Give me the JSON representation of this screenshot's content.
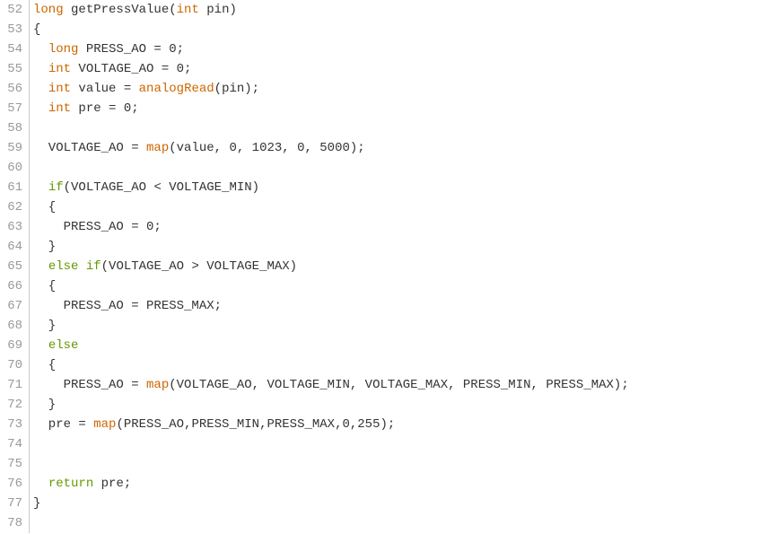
{
  "lines": [
    {
      "n": 52,
      "tokens": [
        {
          "t": "long",
          "c": "kw-type"
        },
        {
          "t": " ",
          "c": ""
        },
        {
          "t": "getPressValue",
          "c": "kw-ident"
        },
        {
          "t": "(",
          "c": "kw-punct"
        },
        {
          "t": "int",
          "c": "kw-type"
        },
        {
          "t": " pin)",
          "c": "kw-ident"
        }
      ]
    },
    {
      "n": 53,
      "tokens": [
        {
          "t": "{",
          "c": "kw-punct"
        }
      ]
    },
    {
      "n": 54,
      "tokens": [
        {
          "t": "  ",
          "c": ""
        },
        {
          "t": "long",
          "c": "kw-type"
        },
        {
          "t": " PRESS_AO = 0;",
          "c": "kw-ident"
        }
      ]
    },
    {
      "n": 55,
      "tokens": [
        {
          "t": "  ",
          "c": ""
        },
        {
          "t": "int",
          "c": "kw-type"
        },
        {
          "t": " VOLTAGE_AO = 0;",
          "c": "kw-ident"
        }
      ]
    },
    {
      "n": 56,
      "tokens": [
        {
          "t": "  ",
          "c": ""
        },
        {
          "t": "int",
          "c": "kw-type"
        },
        {
          "t": " value = ",
          "c": "kw-ident"
        },
        {
          "t": "analogRead",
          "c": "kw-func"
        },
        {
          "t": "(pin);",
          "c": "kw-ident"
        }
      ]
    },
    {
      "n": 57,
      "tokens": [
        {
          "t": "  ",
          "c": ""
        },
        {
          "t": "int",
          "c": "kw-type"
        },
        {
          "t": " pre = 0;",
          "c": "kw-ident"
        }
      ]
    },
    {
      "n": 58,
      "tokens": [
        {
          "t": "",
          "c": ""
        }
      ]
    },
    {
      "n": 59,
      "tokens": [
        {
          "t": "  VOLTAGE_AO = ",
          "c": "kw-ident"
        },
        {
          "t": "map",
          "c": "kw-func"
        },
        {
          "t": "(value, 0, 1023, 0, 5000);",
          "c": "kw-ident"
        }
      ]
    },
    {
      "n": 60,
      "tokens": [
        {
          "t": "",
          "c": ""
        }
      ]
    },
    {
      "n": 61,
      "tokens": [
        {
          "t": "  ",
          "c": ""
        },
        {
          "t": "if",
          "c": "kw-ctrl"
        },
        {
          "t": "(VOLTAGE_AO < VOLTAGE_MIN)",
          "c": "kw-ident"
        }
      ]
    },
    {
      "n": 62,
      "tokens": [
        {
          "t": "  {",
          "c": "kw-punct"
        }
      ]
    },
    {
      "n": 63,
      "tokens": [
        {
          "t": "    PRESS_AO = 0;",
          "c": "kw-ident"
        }
      ]
    },
    {
      "n": 64,
      "tokens": [
        {
          "t": "  }",
          "c": "kw-punct"
        }
      ]
    },
    {
      "n": 65,
      "tokens": [
        {
          "t": "  ",
          "c": ""
        },
        {
          "t": "else",
          "c": "kw-ctrl"
        },
        {
          "t": " ",
          "c": ""
        },
        {
          "t": "if",
          "c": "kw-ctrl"
        },
        {
          "t": "(VOLTAGE_AO > VOLTAGE_MAX)",
          "c": "kw-ident"
        }
      ]
    },
    {
      "n": 66,
      "tokens": [
        {
          "t": "  {",
          "c": "kw-punct"
        }
      ]
    },
    {
      "n": 67,
      "tokens": [
        {
          "t": "    PRESS_AO = PRESS_MAX;",
          "c": "kw-ident"
        }
      ]
    },
    {
      "n": 68,
      "tokens": [
        {
          "t": "  }",
          "c": "kw-punct"
        }
      ]
    },
    {
      "n": 69,
      "tokens": [
        {
          "t": "  ",
          "c": ""
        },
        {
          "t": "else",
          "c": "kw-ctrl"
        }
      ]
    },
    {
      "n": 70,
      "tokens": [
        {
          "t": "  {",
          "c": "kw-punct"
        }
      ]
    },
    {
      "n": 71,
      "tokens": [
        {
          "t": "    PRESS_AO = ",
          "c": "kw-ident"
        },
        {
          "t": "map",
          "c": "kw-func"
        },
        {
          "t": "(VOLTAGE_AO, VOLTAGE_MIN, VOLTAGE_MAX, PRESS_MIN, PRESS_MAX);",
          "c": "kw-ident"
        }
      ]
    },
    {
      "n": 72,
      "tokens": [
        {
          "t": "  }",
          "c": "kw-punct"
        }
      ]
    },
    {
      "n": 73,
      "tokens": [
        {
          "t": "  pre = ",
          "c": "kw-ident"
        },
        {
          "t": "map",
          "c": "kw-func"
        },
        {
          "t": "(PRESS_AO,PRESS_MIN,PRESS_MAX,0,255);",
          "c": "kw-ident"
        }
      ]
    },
    {
      "n": 74,
      "tokens": [
        {
          "t": "",
          "c": ""
        }
      ]
    },
    {
      "n": 75,
      "tokens": [
        {
          "t": "",
          "c": ""
        }
      ]
    },
    {
      "n": 76,
      "tokens": [
        {
          "t": "  ",
          "c": ""
        },
        {
          "t": "return",
          "c": "kw-ctrl"
        },
        {
          "t": " pre;",
          "c": "kw-ident"
        }
      ]
    },
    {
      "n": 77,
      "tokens": [
        {
          "t": "}",
          "c": "kw-punct"
        }
      ]
    },
    {
      "n": 78,
      "tokens": [
        {
          "t": "",
          "c": ""
        }
      ]
    }
  ]
}
